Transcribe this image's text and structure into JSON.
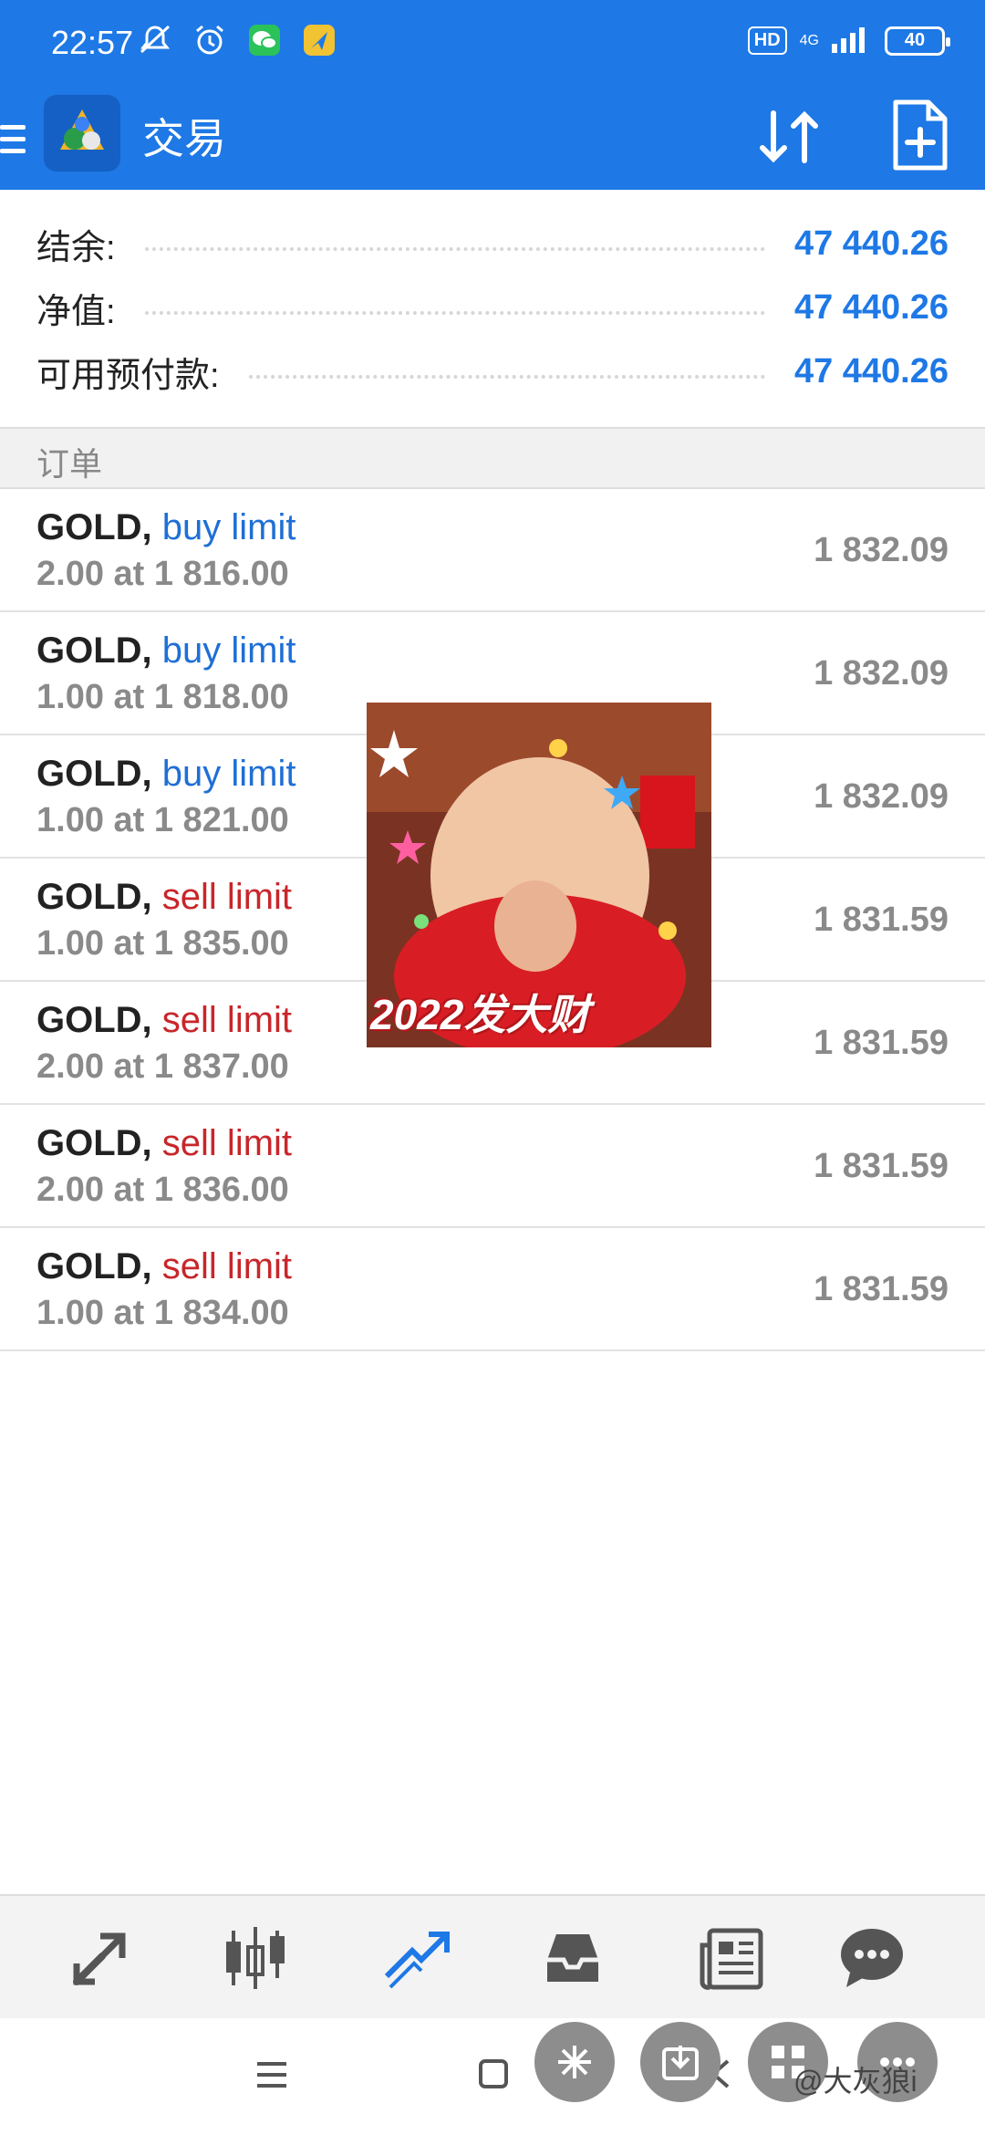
{
  "status_bar": {
    "time": "22:57",
    "hd": "HD",
    "network": "4G",
    "battery": "40"
  },
  "app_bar": {
    "title": "交易",
    "icons": [
      "menu-icon",
      "metatrader-logo",
      "sort-icon",
      "new-order-icon"
    ]
  },
  "summary": [
    {
      "label": "结余:",
      "value": "47 440.26"
    },
    {
      "label": "净值:",
      "value": "47 440.26"
    },
    {
      "label": "可用预付款:",
      "value": "47 440.26"
    }
  ],
  "orders_section": {
    "title": "订单"
  },
  "orders": [
    {
      "symbol": "GOLD,",
      "type": "buy limit",
      "side": "buy",
      "detail": "2.00 at 1 816.00",
      "price": "1 832.09"
    },
    {
      "symbol": "GOLD,",
      "type": "buy limit",
      "side": "buy",
      "detail": "1.00 at 1 818.00",
      "price": "1 832.09"
    },
    {
      "symbol": "GOLD,",
      "type": "buy limit",
      "side": "buy",
      "detail": "1.00 at 1 821.00",
      "price": "1 832.09"
    },
    {
      "symbol": "GOLD,",
      "type": "sell limit",
      "side": "sell",
      "detail": "1.00 at 1 835.00",
      "price": "1 831.59"
    },
    {
      "symbol": "GOLD,",
      "type": "sell limit",
      "side": "sell",
      "detail": "2.00 at 1 837.00",
      "price": "1 831.59"
    },
    {
      "symbol": "GOLD,",
      "type": "sell limit",
      "side": "sell",
      "detail": "2.00 at 1 836.00",
      "price": "1 831.59"
    },
    {
      "symbol": "GOLD,",
      "type": "sell limit",
      "side": "sell",
      "detail": "1.00 at 1 834.00",
      "price": "1 831.59"
    }
  ],
  "sticker": {
    "caption": "2022发大财"
  },
  "tabs": [
    "quotes-icon",
    "chart-icon",
    "trade-icon",
    "history-icon",
    "news-icon",
    "chat-icon"
  ],
  "colors": {
    "accent": "#1e78e6",
    "buy": "#1e6fd6",
    "sell": "#c8262a",
    "muted": "#8a8a8a"
  },
  "watermark": "@大灰狼i"
}
